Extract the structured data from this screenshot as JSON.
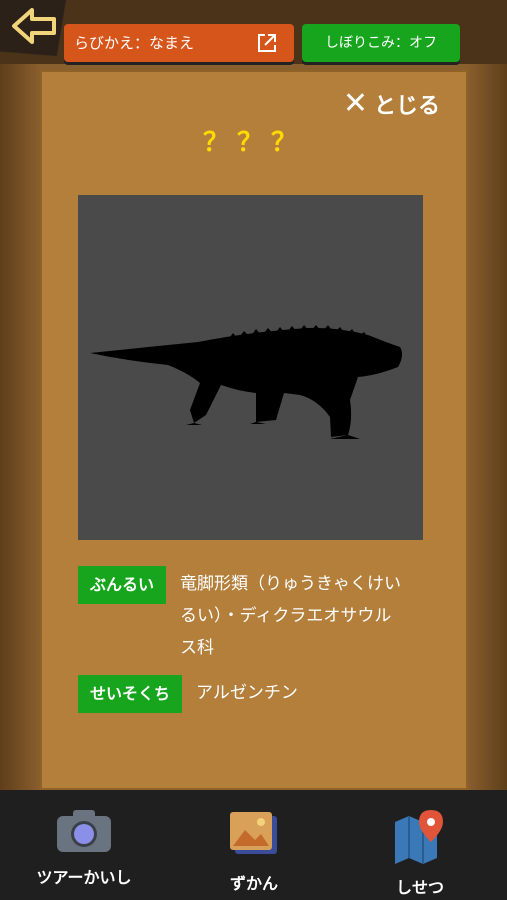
{
  "header": {
    "sort_label": "らびかえ：なまえ",
    "filter_label": "しぼりこみ：オフ"
  },
  "panel": {
    "close_label": "とじる",
    "title": "？？？",
    "fields": [
      {
        "tag": "ぶんるい",
        "value": "竜脚形類（りゅうきゃくけいるい）・ディクラエオサウルス科"
      },
      {
        "tag": "せいそくち",
        "value": "アルゼンチン"
      }
    ]
  },
  "nav": [
    {
      "label": "ツアーかいし",
      "icon": "camera-icon"
    },
    {
      "label": "ずかん",
      "icon": "gallery-icon"
    },
    {
      "label": "しせつ",
      "icon": "map-pin-icon"
    }
  ],
  "colors": {
    "accent_orange": "#d6551a",
    "accent_green": "#18a51e",
    "title_yellow": "#ffd900"
  }
}
